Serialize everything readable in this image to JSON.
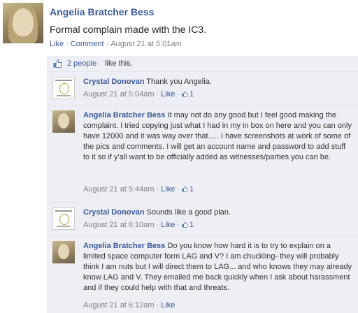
{
  "post": {
    "author": "Angelia Bratcher Bess",
    "text": "Formal complain made with the IC3.",
    "like_label": "Like",
    "comment_label": "Comment",
    "timestamp": "August 21 at 5:01am"
  },
  "likes": {
    "count_label": "2 people",
    "suffix": "like this."
  },
  "comments": [
    {
      "author": "Crystal Donovan",
      "text": "Thank you Angelia.",
      "timestamp": "August 21 at 5:04am",
      "like_label": "Like",
      "like_count": "1"
    },
    {
      "author": "Angelia Bratcher Bess",
      "text": "It may not do any good but I feel good making the complaint. I tried copying just what I had in my in box on here and you can only have 12000 and it was way over that..... I have screenshots at work of some of the pics and comments. I will get an account name and password to add stuff to it so if y'all want to be officially added as witnesses/parties you can be.",
      "timestamp": "August 21 at 5:44am",
      "like_label": "Like",
      "like_count": "1"
    },
    {
      "author": "Crystal Donovan",
      "text": "Sounds like a good plan.",
      "timestamp": "August 21 at 6:10am",
      "like_label": "Like",
      "like_count": "1"
    },
    {
      "author": "Angelia Bratcher Bess",
      "text": "Do you know how hard it is to try to explain on a limited space computer form LAG and V? I am chuckling- they will probably think I am nuts but I will direct them to LAG... and who knows they may already know LAG and V. They emailed me back quickly when I ask about harassment and if they could help with that and threats.",
      "timestamp": "August 21 at 6:12am",
      "like_label": "Like"
    }
  ],
  "colors": {
    "link": "#3b5998",
    "comment_bg": "#edeff4",
    "meta": "#808080"
  }
}
